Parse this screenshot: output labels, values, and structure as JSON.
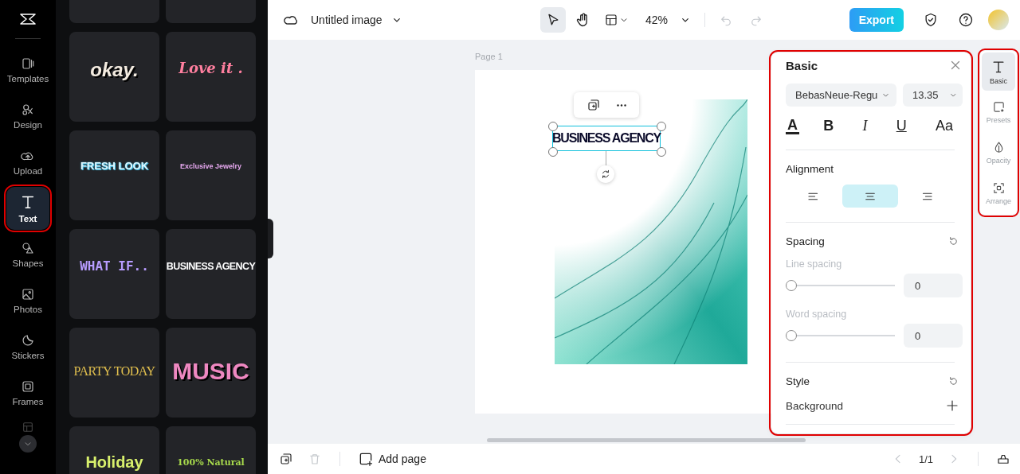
{
  "rail": {
    "items": [
      {
        "label": "Templates",
        "selected": false,
        "highlighted": false
      },
      {
        "label": "Design",
        "selected": false,
        "highlighted": false
      },
      {
        "label": "Upload",
        "selected": false,
        "highlighted": false
      },
      {
        "label": "Text",
        "selected": true,
        "highlighted": true
      },
      {
        "label": "Shapes",
        "selected": false,
        "highlighted": false
      },
      {
        "label": "Photos",
        "selected": false,
        "highlighted": false
      },
      {
        "label": "Stickers",
        "selected": false,
        "highlighted": false
      },
      {
        "label": "Frames",
        "selected": false,
        "highlighted": false
      }
    ]
  },
  "presets": [
    {
      "kind": "blank"
    },
    {
      "kind": "blank"
    },
    {
      "kind": "okay",
      "text": "okay."
    },
    {
      "kind": "love",
      "text": "Love it ."
    },
    {
      "kind": "fresh",
      "text": "FRESH LOOK"
    },
    {
      "kind": "jewelry",
      "text": "Exclusive Jewelry"
    },
    {
      "kind": "whatif",
      "text": "WHAT IF.."
    },
    {
      "kind": "business",
      "text": "BUSINESS AGENCY"
    },
    {
      "kind": "party",
      "text": "PARTY TODAY"
    },
    {
      "kind": "music",
      "text": "MUSIC"
    },
    {
      "kind": "holiday",
      "text": "Holiday"
    },
    {
      "kind": "natural",
      "text": "100% Natural"
    }
  ],
  "topbar": {
    "title": "Untitled image",
    "zoom": "42%",
    "export": "Export"
  },
  "canvas": {
    "page_label": "Page 1",
    "text_box": "BUSINESS AGENCY"
  },
  "properties": {
    "highlighted": true,
    "title": "Basic",
    "font": "BebasNeue-Regu",
    "size": "13.35",
    "format": [
      {
        "kind": "color",
        "label": "A"
      },
      {
        "kind": "bold",
        "label": "B"
      },
      {
        "kind": "italic",
        "label": "I"
      },
      {
        "kind": "underline",
        "label": "U"
      },
      {
        "kind": "case",
        "label": "Aa"
      }
    ],
    "alignment_title": "Alignment",
    "alignment": [
      {
        "kind": "left",
        "selected": false
      },
      {
        "kind": "center",
        "selected": true
      },
      {
        "kind": "right",
        "selected": false
      }
    ],
    "spacing_title": "Spacing",
    "sliders": [
      {
        "label": "Line spacing",
        "level": 0,
        "value": "0"
      },
      {
        "label": "Word spacing",
        "level": 0,
        "value": "0"
      }
    ],
    "style_title": "Style",
    "background_label": "Background"
  },
  "side_tabs": {
    "highlighted": true,
    "items": [
      {
        "label": "Basic",
        "selected": true
      },
      {
        "label": "Presets",
        "selected": false
      },
      {
        "label": "Opacity",
        "selected": false
      },
      {
        "label": "Arrange",
        "selected": false
      }
    ]
  },
  "bottombar": {
    "add_page": "Add page",
    "pages": "1/1"
  }
}
